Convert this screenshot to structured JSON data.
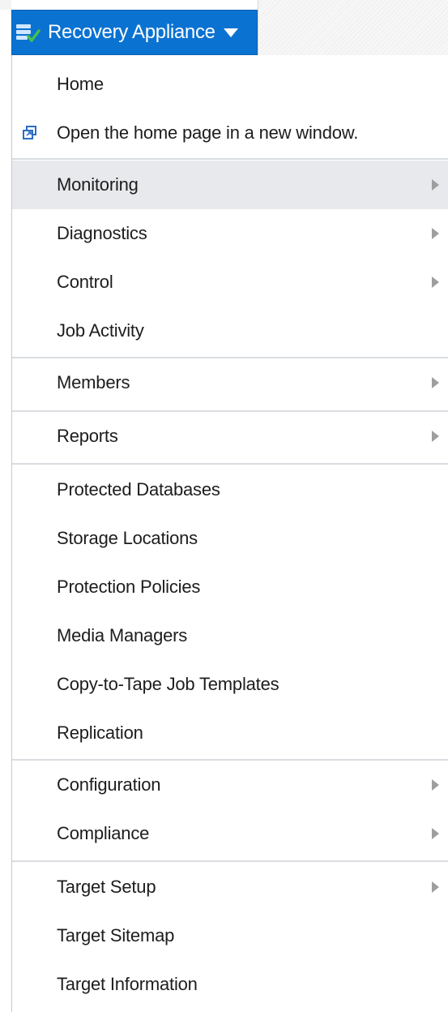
{
  "menu_button": {
    "title": "Recovery Appliance",
    "icon": "recovery-appliance-icon",
    "color": "#0a72d1"
  },
  "menu": {
    "items": [
      {
        "label": "Home",
        "submenu": false
      },
      {
        "label": "Open the home page in a new window.",
        "submenu": false,
        "icon": "new-window-icon"
      },
      {
        "label": "Monitoring",
        "submenu": true,
        "highlighted": true
      },
      {
        "label": "Diagnostics",
        "submenu": true
      },
      {
        "label": "Control",
        "submenu": true
      },
      {
        "label": "Job Activity",
        "submenu": false
      },
      {
        "label": "Members",
        "submenu": true
      },
      {
        "label": "Reports",
        "submenu": true
      },
      {
        "label": "Protected Databases",
        "submenu": false
      },
      {
        "label": "Storage Locations",
        "submenu": false
      },
      {
        "label": "Protection Policies",
        "submenu": false
      },
      {
        "label": "Media Managers",
        "submenu": false
      },
      {
        "label": "Copy-to-Tape Job Templates",
        "submenu": false
      },
      {
        "label": "Replication",
        "submenu": false
      },
      {
        "label": "Configuration",
        "submenu": true
      },
      {
        "label": "Compliance",
        "submenu": true
      },
      {
        "label": "Target Setup",
        "submenu": true
      },
      {
        "label": "Target Sitemap",
        "submenu": false
      },
      {
        "label": "Target Information",
        "submenu": false
      }
    ]
  },
  "colors": {
    "highlight": "#e7e9ec",
    "separator": "#dadde1",
    "submenu_arrow": "#9e9e9e"
  }
}
